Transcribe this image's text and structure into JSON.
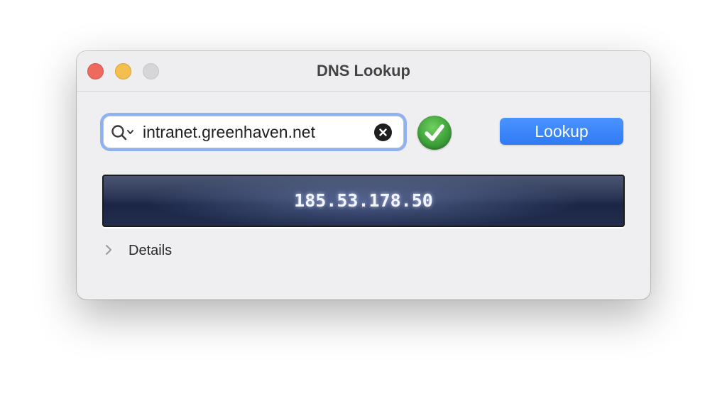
{
  "window": {
    "title": "DNS Lookup"
  },
  "search": {
    "value": "intranet.greenhaven.net",
    "icon": "magnifying-glass-icon"
  },
  "status": {
    "icon": "checkmark-icon",
    "color": "#3fa23a"
  },
  "lookup_button": {
    "label": "Lookup",
    "color": "#2f7bf4"
  },
  "result": {
    "text": "185.53.178.50"
  },
  "details": {
    "label": "Details",
    "icon": "chevron-right-icon"
  },
  "colors": {
    "close": "#ee6a5e",
    "minimize": "#f5bf4f",
    "zoom": "#d6d6d8",
    "focus_ring": "#8eb1f2"
  }
}
